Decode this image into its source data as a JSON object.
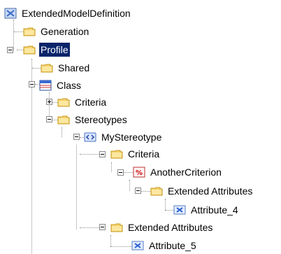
{
  "tree": {
    "root": {
      "label": "ExtendedModelDefinition",
      "icon": "model-definition-icon"
    },
    "generation": {
      "label": "Generation",
      "icon": "folder-icon"
    },
    "profile": {
      "label": "Profile",
      "icon": "folder-icon",
      "selected": true
    },
    "shared": {
      "label": "Shared",
      "icon": "folder-icon"
    },
    "class": {
      "label": "Class",
      "icon": "class-icon"
    },
    "criteria": {
      "label": "Criteria",
      "icon": "folder-icon"
    },
    "stereotypes": {
      "label": "Stereotypes",
      "icon": "folder-icon"
    },
    "my_stereotype": {
      "label": "MyStereotype",
      "icon": "stereotype-icon"
    },
    "inner_criteria": {
      "label": "Criteria",
      "icon": "folder-icon"
    },
    "another_criterion": {
      "label": "AnotherCriterion",
      "icon": "criterion-icon"
    },
    "ext_attrs_1": {
      "label": "Extended Attributes",
      "icon": "folder-icon"
    },
    "attribute_4": {
      "label": "Attribute_4",
      "icon": "attribute-icon"
    },
    "ext_attrs_2": {
      "label": "Extended Attributes",
      "icon": "folder-icon"
    },
    "attribute_5": {
      "label": "Attribute_5",
      "icon": "attribute-icon"
    }
  }
}
